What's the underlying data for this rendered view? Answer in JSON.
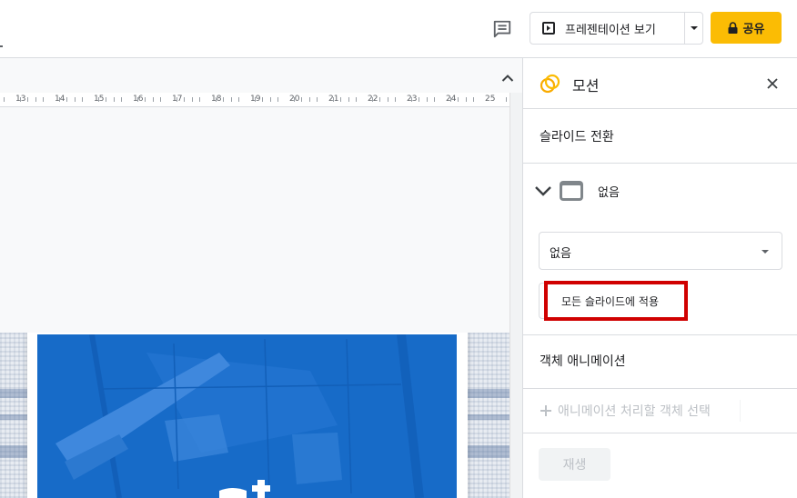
{
  "toolbar": {
    "present_label": "프레젠테이션 보기",
    "share_label": "공유"
  },
  "ruler": {
    "labels": [
      "13",
      "14",
      "15",
      "16",
      "17",
      "18",
      "19",
      "20",
      "21",
      "22",
      "23",
      "24",
      "25"
    ]
  },
  "motion_panel": {
    "title": "모션",
    "slide_transition_title": "슬라이드 전환",
    "current_transition": "없음",
    "transition_select_value": "없음",
    "apply_all_label": "모든 슬라이드에 적용",
    "object_animation_title": "객체 애니메이션",
    "add_animation_label": "애니메이션 처리할 객체 선택",
    "play_label": "재생"
  },
  "icons": {
    "comments": "comments-icon",
    "present": "play-box-icon",
    "present_dropdown": "caret-down-icon",
    "share": "lock-icon",
    "collapse": "chevron-up-icon",
    "motion": "motion-rings-icon",
    "close": "close-icon",
    "expand": "chevron-down-icon",
    "add": "plus-icon"
  },
  "colors": {
    "share_button": "#fbbc04",
    "highlight_box": "#d00000",
    "slide_photo_tint": "#1a6fcc",
    "motion_icon": "#f9ab00"
  }
}
